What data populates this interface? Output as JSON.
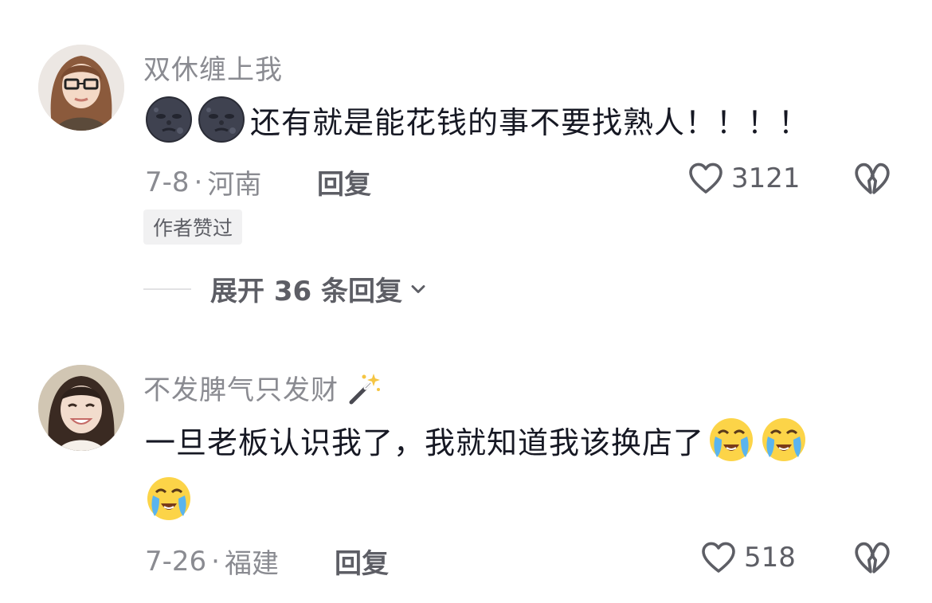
{
  "comments": [
    {
      "username": "双休缠上我",
      "content": "还有就是能花钱的事不要找熟人！！！！",
      "leading_emojis": [
        "new-moon-face-emoji",
        "new-moon-face-emoji"
      ],
      "date": "7-8",
      "location": "河南",
      "reply_label": "回复",
      "likes": "3121",
      "badge": "作者赞过",
      "expand_label": "展开 36 条回复"
    },
    {
      "username": "不发脾气只发财",
      "username_emoji": "magic-wand-emoji",
      "content": "一旦老板认识我了，我就知道我该换店了",
      "trailing_emojis": [
        "crying-face-emoji",
        "crying-face-emoji",
        "crying-face-emoji"
      ],
      "date": "7-26",
      "location": "福建",
      "reply_label": "回复",
      "likes": "518"
    }
  ],
  "separator": "·",
  "colors": {
    "primary_text": "#161823",
    "secondary_text": "#8a8b91",
    "action_text": "#5d5e65"
  }
}
